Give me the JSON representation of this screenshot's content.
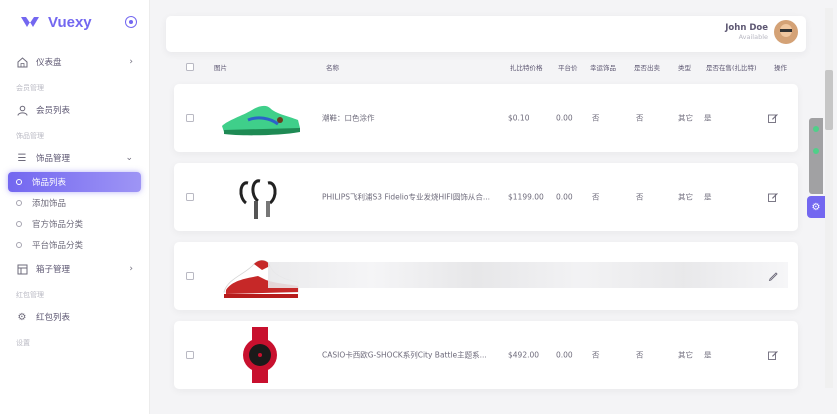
{
  "brand": {
    "name": "Vuexy"
  },
  "user": {
    "name": "John Doe",
    "status": "Available"
  },
  "sidebar": {
    "dashboard": "仪表盘",
    "sections": {
      "members": "会员管理",
      "items": "饰品管理",
      "redpacket": "红包管理",
      "settings": "设置"
    },
    "member_list": "会员列表",
    "item_mgmt": "饰品管理",
    "item_subs": [
      "饰品列表",
      "添加饰品",
      "官方饰品分类",
      "平台饰品分类"
    ],
    "box_mgmt": "箱子管理",
    "redpacket_list": "红包列表"
  },
  "table": {
    "headers": [
      "图片",
      "名称",
      "扎比特价格",
      "平台价",
      "幸运饰品",
      "是否出卖",
      "类型",
      "是否在售(扎比特)",
      "操作"
    ],
    "rows": [
      {
        "name": "潮鞋：口色涂作",
        "price": "$0.10",
        "platform": "0.00",
        "lucky": "否",
        "sell": "否",
        "type": "其它",
        "onsale": "是"
      },
      {
        "name": "PHILIPS飞利浦S3 Fidelio专业发烧HIFI圆饰从合...",
        "price": "$1199.00",
        "platform": "0.00",
        "lucky": "否",
        "sell": "否",
        "type": "其它",
        "onsale": "是"
      },
      {
        "name": "",
        "price": "",
        "platform": "",
        "lucky": "",
        "sell": "",
        "type": "",
        "onsale": ""
      },
      {
        "name": "CASIO卡西欧G-SHOCK系列City Battle主题系...",
        "price": "$492.00",
        "platform": "0.00",
        "lucky": "否",
        "sell": "否",
        "type": "其它",
        "onsale": "是"
      }
    ]
  },
  "colors": {
    "accent": "#7367f0",
    "text": "#5e5873"
  },
  "icons": [
    "heart-logo-icon",
    "pin-icon",
    "home-icon",
    "user-icon",
    "list-icon",
    "box-icon",
    "gift-icon",
    "edit-icon",
    "settings-icon"
  ]
}
